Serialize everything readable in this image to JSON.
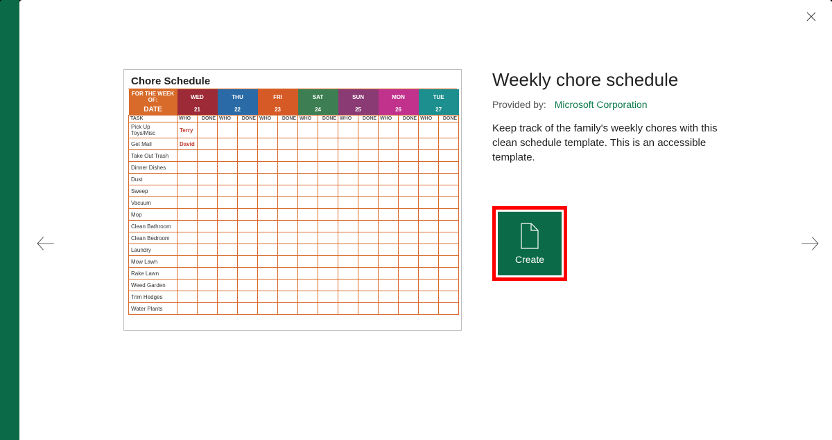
{
  "close_label": "Close",
  "nav": {
    "prev": "Previous template",
    "next": "Next template"
  },
  "preview": {
    "title": "Chore Schedule",
    "for_week_label": "FOR THE WEEK OF:",
    "date_label": "DATE",
    "days": [
      "WED",
      "THU",
      "FRI",
      "SAT",
      "SUN",
      "MON",
      "TUE"
    ],
    "dates": [
      "21",
      "22",
      "23",
      "24",
      "25",
      "26",
      "27"
    ],
    "col_task": "TASK",
    "col_who": "WHO",
    "col_done": "DONE",
    "tasks": [
      "Pick Up Toys/Misc",
      "Get Mail",
      "Take Out Trash",
      "Dinner Dishes",
      "Dust",
      "Sweep",
      "Vacuum",
      "Mop",
      "Clean Bathroom",
      "Clean Bedroom",
      "Laundry",
      "Mow Lawn",
      "Rake Lawn",
      "Weed Garden",
      "Trim Hedges",
      "Water Plants"
    ],
    "assignments": {
      "0": "Terry",
      "1": "David"
    }
  },
  "detail": {
    "title": "Weekly chore schedule",
    "provided_by_label": "Provided by:",
    "provider": "Microsoft Corporation",
    "description": "Keep track of the family's weekly chores with this clean schedule template. This is an accessible template.",
    "create_label": "Create"
  }
}
